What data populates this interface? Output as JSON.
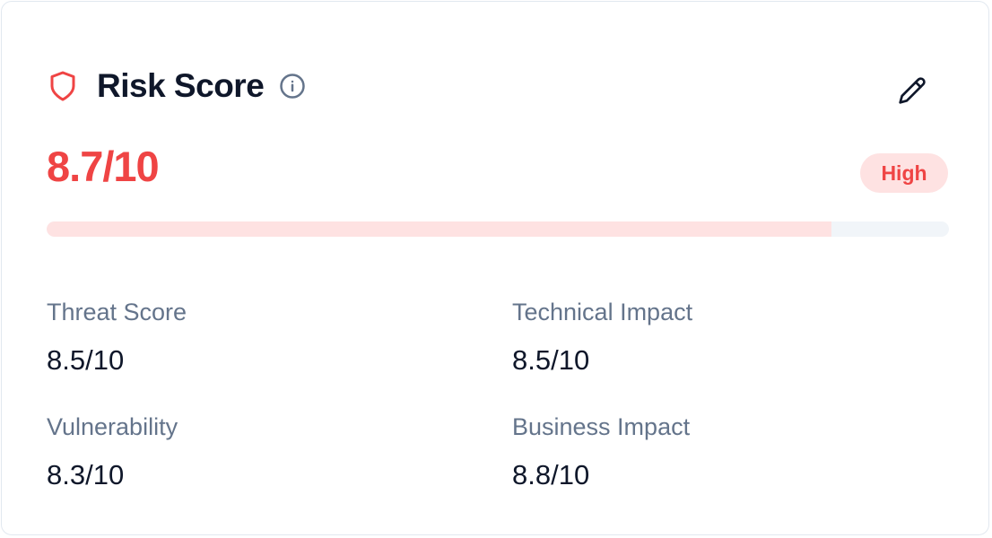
{
  "card": {
    "title": "Risk Score",
    "score": "8.7/10",
    "level": "High",
    "progress": 0.87,
    "icons": {
      "header": "shield-icon",
      "info": "info-icon",
      "edit": "pencil-icon"
    },
    "colors": {
      "accent": "#ef4444",
      "badge_bg": "#fee2e2",
      "track": "#f1f5f9",
      "fill": "#fee2e2"
    },
    "metrics": [
      {
        "label": "Threat Score",
        "value": "8.5/10"
      },
      {
        "label": "Technical Impact",
        "value": "8.5/10"
      },
      {
        "label": "Vulnerability",
        "value": "8.3/10"
      },
      {
        "label": "Business Impact",
        "value": "8.8/10"
      }
    ]
  }
}
